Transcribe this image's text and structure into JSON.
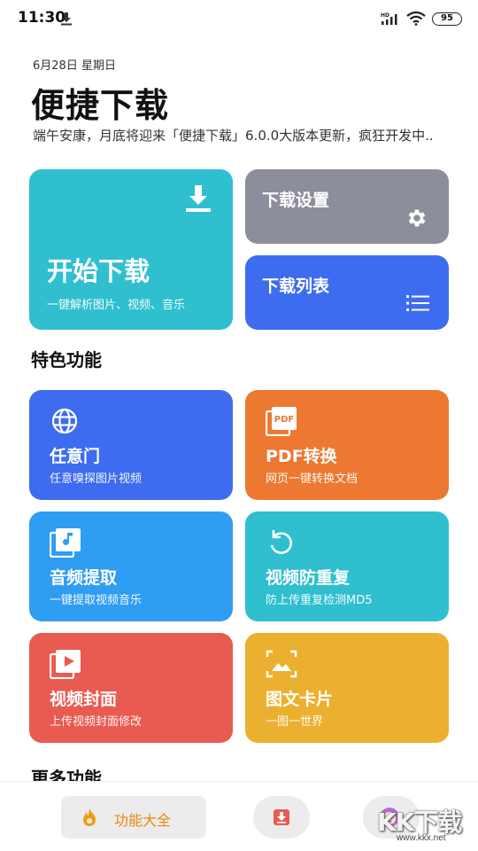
{
  "status_bar": {
    "time": "11:30",
    "battery": "95",
    "icons": [
      "download-icon",
      "signal-icon",
      "wifi-icon",
      "battery-icon"
    ]
  },
  "header": {
    "date": "6月28日 星期日",
    "title": "便捷下载",
    "subtitle": "端午安康，月底将迎来「便捷下载」6.0.0大版本更新，疯狂开发中.."
  },
  "main_cards": {
    "start": {
      "title": "开始下载",
      "subtitle": "一键解析图片、视频、音乐",
      "color": "#2fbfcf",
      "icon": "download-icon"
    },
    "settings": {
      "title": "下载设置",
      "color": "#8d8e9c",
      "icon": "gear-icon"
    },
    "list": {
      "title": "下载列表",
      "color": "#3d6cf0",
      "icon": "list-icon"
    }
  },
  "features_section": {
    "title": "特色功能",
    "items": [
      {
        "title": "任意门",
        "subtitle": "任意嗅探图片视频",
        "color": "#3d6cf0",
        "icon": "globe-icon"
      },
      {
        "title": "PDF转换",
        "subtitle": "网页一键转换文档",
        "color": "#ec7831",
        "icon": "pdf-icon"
      },
      {
        "title": "音频提取",
        "subtitle": "一键提取视频音乐",
        "color": "#2f9df2",
        "icon": "music-library-icon"
      },
      {
        "title": "视频防重复",
        "subtitle": "防上传重复检测MD5",
        "color": "#2fbfcf",
        "icon": "refresh-icon"
      },
      {
        "title": "视频封面",
        "subtitle": "上传视频封面修改",
        "color": "#e95a51",
        "icon": "video-library-icon"
      },
      {
        "title": "图文卡片",
        "subtitle": "一图一世界",
        "color": "#ebb02f",
        "icon": "image-icon"
      }
    ]
  },
  "more_section": {
    "title": "更多功能"
  },
  "bottom_nav": {
    "tabs": [
      {
        "label": "功能大全",
        "icon": "fire-icon",
        "active": true
      },
      {
        "label": "",
        "icon": "download-box-icon",
        "active": false
      },
      {
        "label": "",
        "icon": "avatar-icon",
        "active": false
      }
    ]
  },
  "watermark": {
    "logo": "KK下载",
    "url": "www.kkx.net"
  }
}
